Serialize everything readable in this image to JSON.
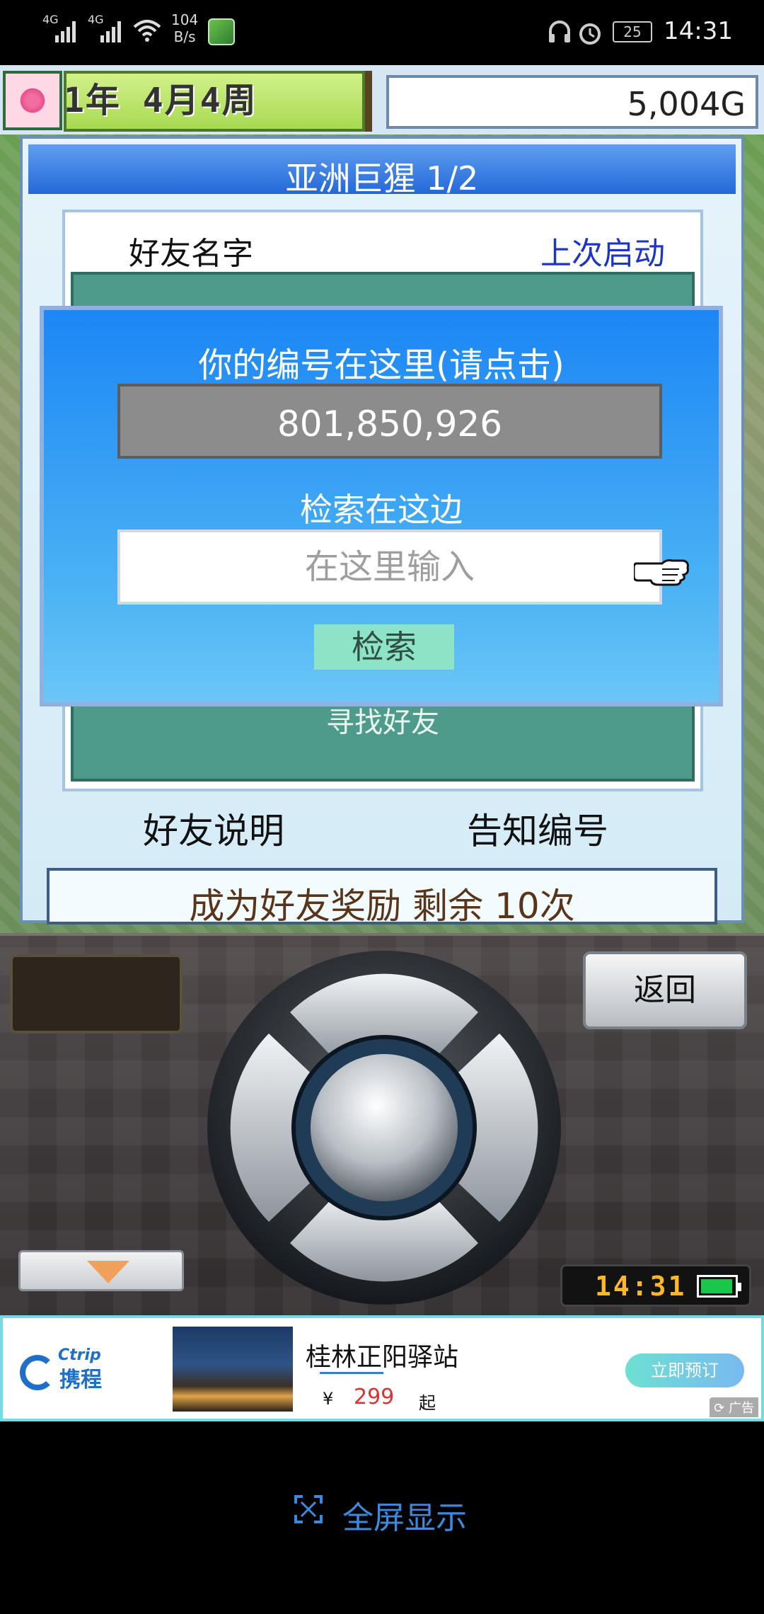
{
  "status_bar": {
    "network_1": "4G",
    "network_2": "4G",
    "net_speed_value": "104",
    "net_speed_unit": "B/s",
    "battery_level": "25",
    "time": "14:31"
  },
  "top_bar": {
    "date": "1年 4月4周",
    "money": "5,004G"
  },
  "friend_window": {
    "title": "亚洲巨猩 1/2",
    "col_name": "好友名字",
    "col_last_launch": "上次启动",
    "find_friend": "寻找好友",
    "help_button": "好友说明",
    "tell_id_button": "告知编号"
  },
  "reward_bar": {
    "text": "成为好友奖励 剩余 10次"
  },
  "search_modal": {
    "your_id_label": "你的编号在这里(请点击)",
    "your_id_value": "801,850,926",
    "search_label": "检索在这边",
    "search_placeholder": "在这里输入",
    "search_button": "检索"
  },
  "controller": {
    "back_button": "返回",
    "clock": "14:31"
  },
  "ad": {
    "brand_en": "Ctrip",
    "brand_cn": "携程",
    "title": "桂林正阳驿站",
    "currency": "¥",
    "price": "299",
    "price_suffix": "起",
    "cta": "立即预订",
    "tag": "广告"
  },
  "fullscreen": {
    "label": "全屏显示"
  },
  "colors": {
    "accent_blue": "#2468d8",
    "teal_list": "#4e9b8b",
    "search_button": "#8de3c5",
    "reward_text": "#5a3418",
    "price_red": "#e23030"
  }
}
